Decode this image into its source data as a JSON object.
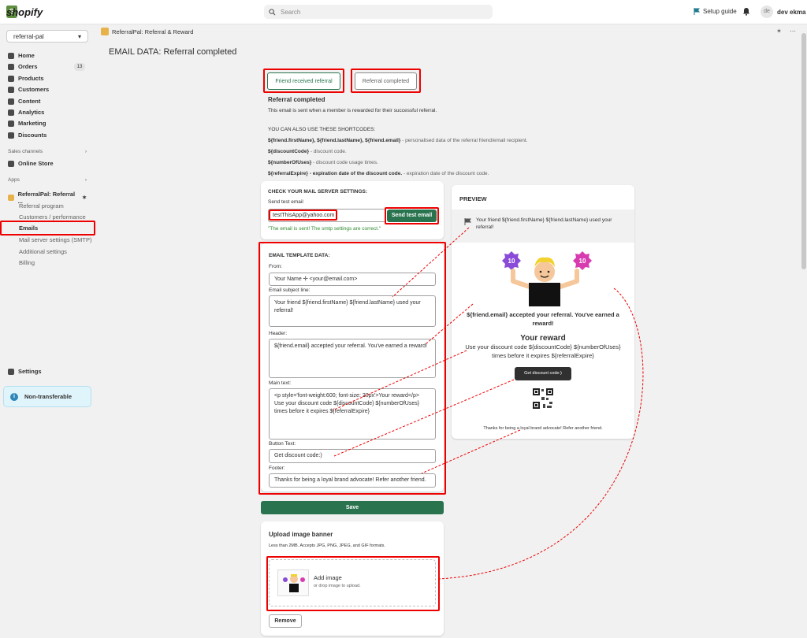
{
  "topbar": {
    "brand": "shopify",
    "search_placeholder": "Search",
    "setup_guide": "Setup guide",
    "avatar_initials": "de",
    "user_name": "dev ekma"
  },
  "sidebar": {
    "store": "referral-pal",
    "items": [
      {
        "label": "Home"
      },
      {
        "label": "Orders",
        "badge": "13"
      },
      {
        "label": "Products"
      },
      {
        "label": "Customers"
      },
      {
        "label": "Content"
      },
      {
        "label": "Analytics"
      },
      {
        "label": "Marketing"
      },
      {
        "label": "Discounts"
      }
    ],
    "sales_channels_label": "Sales channels",
    "online_store": "Online Store",
    "apps_label": "Apps",
    "app_name": "ReferralPal: Referral ...",
    "app_sub": [
      "Referral program",
      "Customers / performance",
      "Emails",
      "Mail server settings (SMTP)",
      "Additional settings",
      "Billing"
    ],
    "settings": "Settings",
    "non_transferable": "Non-transferable"
  },
  "appbar": {
    "title": "ReferralPal: Referral & Reward",
    "actions": "✶ ⋯"
  },
  "page": {
    "title": "EMAIL DATA: Referral completed"
  },
  "tabs": {
    "friend_received": "Friend received referral",
    "referral_completed": "Referral completed"
  },
  "info": {
    "heading": "Referral completed",
    "desc": "This email is sent when a member is rewarded for their successful referral.",
    "shortcodes_heading": "YOU CAN ALSO USE THESE SHORTCODES:",
    "sc1_code": "${friend.firstName}, ${friend.lastName}, ${friend.email}",
    "sc1_desc": " - personalised data of the referral friend/email recipient.",
    "sc2_code": "${discountCode}",
    "sc2_desc": " - discount code.",
    "sc3_code": "${numberOfUses}",
    "sc3_desc": " - discount code usage times.",
    "sc4_code": "${referralExpire} - expiration date of the discount code.",
    "sc4_desc": " - expiration date of the discount code."
  },
  "mail": {
    "heading": "CHECK YOUR MAIL SERVER SETTINGS:",
    "send_label": "Send test email",
    "email_value": "testThisApp@yahoo.com",
    "send_button": "Send test email",
    "success": "\"The email is sent! The smtp settings are correct.\""
  },
  "template": {
    "heading": "EMAIL TEMPLATE DATA:",
    "from_label": "From:",
    "from_value": "Your Name ✢ <your@email.com>",
    "subject_label": "Email subject line:",
    "subject_value": "Your friend ${friend.firstName} ${friend.lastName} used your referral!",
    "header_label": "Header:",
    "header_value": "${friend.email} accepted your referral. You've earned a reward!",
    "main_label": "Main text:",
    "main_value": "<p style='font-weight:600; font-size: 20px'>Your reward</p>\nUse your discount code ${discountCode} ${numberOfUses}\ntimes before it expires ${referralExpire}",
    "button_label": "Button Text:",
    "button_value": "Get discount code:)",
    "footer_label": "Footer:",
    "footer_value": "Thanks for being a loyal brand advocate! Refer another friend."
  },
  "save_button": "Save",
  "upload": {
    "heading": "Upload image banner",
    "desc": "Less than 2MB. Accepts JPG, PNG, JPEG, and GIF formats.",
    "add_image": "Add image",
    "drop_text": "or drop image to upload.",
    "remove_button": "Remove"
  },
  "preview": {
    "heading": "PREVIEW",
    "subject": "Your friend ${friend.firstName} ${friend.lastName} used your referral!",
    "badge_text": "10",
    "header": "${friend.email} accepted your referral. You've earned a reward!",
    "reward_title": "Your reward",
    "reward_text": "Use your discount code ${discountCode} ${numberOfUses} times before it expires ${referralExpire}",
    "button": "Get discount code:)",
    "footer": "Thanks for being a loyal brand advocate! Refer another friend."
  },
  "colors": {
    "accent_green": "#29734e",
    "highlight_red": "#e00000",
    "success_green": "#2e8b2e"
  }
}
